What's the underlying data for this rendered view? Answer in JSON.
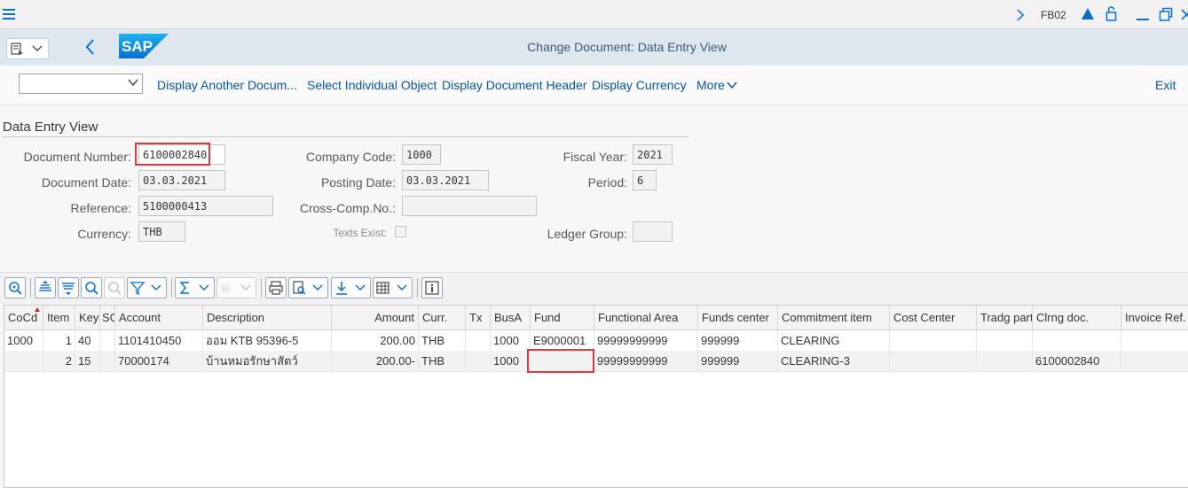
{
  "shell": {
    "tcode": "FB02",
    "icons": [
      "menu-icon",
      "expand-arrow-icon",
      "notification-icon",
      "lock-icon",
      "minimize-icon",
      "restore-icon",
      "close-icon"
    ]
  },
  "title": "Change Document: Data Entry View",
  "logo_text": "SAP",
  "toolbar": {
    "dropdown_value": "",
    "buttons": [
      "Display Another Docum...",
      "Select Individual Object",
      "Display Document Header",
      "Display Currency",
      "More"
    ],
    "exit": "Exit"
  },
  "header": {
    "section_title": "Data Entry View",
    "document_number": {
      "label": "Document Number:",
      "value": "6100002840"
    },
    "company_code": {
      "label": "Company Code:",
      "value": "1000"
    },
    "fiscal_year": {
      "label": "Fiscal Year:",
      "value": "2021"
    },
    "document_date": {
      "label": "Document Date:",
      "value": "03.03.2021"
    },
    "posting_date": {
      "label": "Posting Date:",
      "value": "03.03.2021"
    },
    "period": {
      "label": "Period:",
      "value": "6"
    },
    "reference": {
      "label": "Reference:",
      "value": "5100000413"
    },
    "cross_comp": {
      "label": "Cross-Comp.No.:",
      "value": ""
    },
    "currency": {
      "label": "Currency:",
      "value": "THB"
    },
    "texts_exist": {
      "label": "Texts Exist:",
      "checked": false
    },
    "ledger_group": {
      "label": "Ledger Group:",
      "value": ""
    }
  },
  "grid": {
    "columns": [
      "CoCd",
      "Item",
      "Key",
      "SG",
      "Account",
      "Description",
      "Amount",
      "Curr.",
      "Tx",
      "BusA",
      "Fund",
      "Functional Area",
      "Funds center",
      "Commitment item",
      "Cost Center",
      "Tradg part",
      "Clrng doc.",
      "Invoice Ref."
    ],
    "rows": [
      [
        "1000",
        "1",
        "40",
        "",
        "1101410450",
        "ออม KTB 95396-5",
        "200.00",
        "THB",
        "",
        "1000",
        "E9000001",
        "99999999999",
        "999999",
        "CLEARING",
        "",
        "",
        "",
        ""
      ],
      [
        "",
        "2",
        "15",
        "",
        "70000174",
        "บ้านหมอรักษาสัตว์",
        "200.00-",
        "THB",
        "",
        "1000",
        "",
        "99999999999",
        "999999",
        "CLEARING-3",
        "",
        "",
        "6100002840",
        ""
      ]
    ]
  },
  "colors": {
    "accent": "#0a6ed1",
    "highlight": "#e0393e",
    "title_bar": "#dfe7ee"
  }
}
